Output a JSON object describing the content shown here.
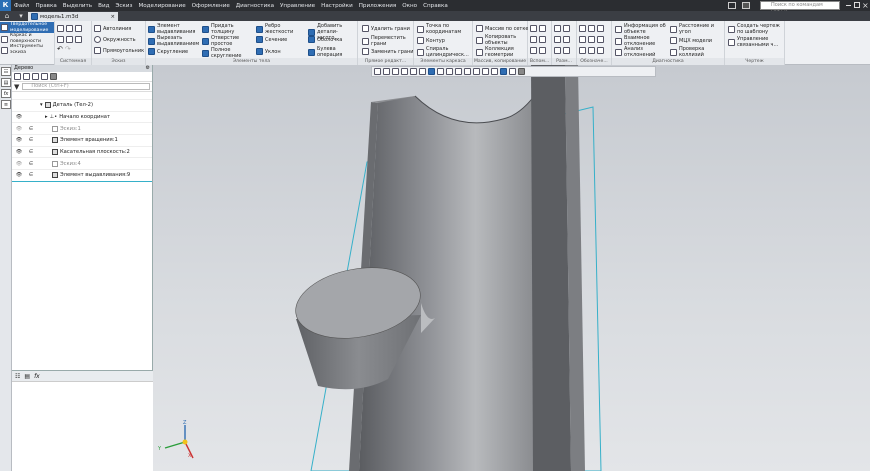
{
  "menu": {
    "items": [
      "Файл",
      "Правка",
      "Выделить",
      "Вид",
      "Эскиз",
      "Моделирование",
      "Оформление",
      "Диагностика",
      "Управление",
      "Настройки",
      "Приложения",
      "Окно",
      "Справка"
    ],
    "search_placeholder": "Поиск по командам (Alt+/)"
  },
  "tabs": {
    "document": "модель1.m3d"
  },
  "ribbon": {
    "modes": [
      "Твердотельное моделирование",
      "Каркас и поверхности",
      "Инструменты эскиза"
    ],
    "sketch_tools": [
      "Автолиния",
      "Окружность",
      "Прямоугольник"
    ],
    "body_tools": [
      "Элемент выдавливания",
      "Вырезать выдавливанием",
      "Скругление",
      "Придать толщину",
      "Отверстие простое",
      "Полное скругление",
      "Ребро жесткости",
      "Сечение",
      "Уклон",
      "Добавить детали-загото...",
      "Оболочка",
      "Булева операция"
    ],
    "edit_tools": [
      "Удалить грани",
      "Переместить грани",
      "Заменить грани"
    ],
    "frame_tools": [
      "Точка по координатам",
      "Контур",
      "Спираль цилиндрическ..."
    ],
    "array_tools": [
      "Массив по сетке",
      "Копировать объекты",
      "Коллекция геометрии"
    ],
    "diag_tools": [
      "Информация об объекте",
      "Взаимное отклонение",
      "Анализ отклонений",
      "Расстояние и угол",
      "МЦХ модели",
      "Проверка коллизий"
    ],
    "drawing_tools": [
      "Создать чертеж по шаблону",
      "Управление связанными ч..."
    ],
    "group_captions": [
      "Системная",
      "Эскиз",
      "Элементы тела",
      "Прямое редакт...",
      "Элементы каркаса",
      "Массив, копирование",
      "Вспом...",
      "Разм...",
      "Обозначе...",
      "Диагностика",
      "Чертеж"
    ]
  },
  "tree": {
    "title": "Дерево",
    "search_placeholder": "Поиск (Ctrl+F)",
    "rows": [
      {
        "label": "Деталь (Тел-2)"
      },
      {
        "label": "Начало координат"
      },
      {
        "label": "Эскиз:1"
      },
      {
        "label": "Элемент вращения:1"
      },
      {
        "label": "Касательная плоскость:2"
      },
      {
        "label": "Эскиз:4"
      },
      {
        "label": "Элемент выдавливания:9"
      }
    ]
  },
  "props": {
    "icons": [
      "tree-view",
      "list-view",
      "formula"
    ]
  },
  "viewport": {
    "axes": {
      "x": "X",
      "y": "Y",
      "z": "Z"
    }
  },
  "colors": {
    "menubar": "#2b2d31",
    "accent": "#2f6db3",
    "selection_plane": "#36b0c9"
  }
}
